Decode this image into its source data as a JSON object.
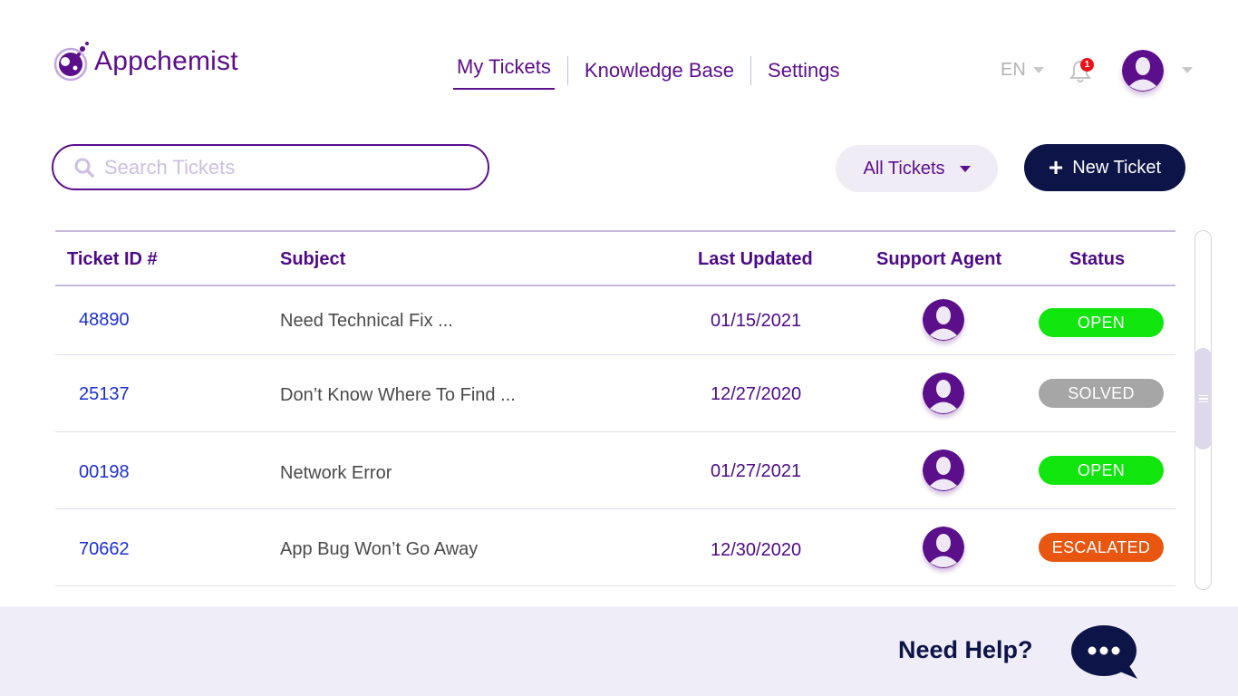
{
  "app": {
    "name": "Appchemist"
  },
  "nav": {
    "items": [
      {
        "label": "My Tickets",
        "active": true
      },
      {
        "label": "Knowledge Base",
        "active": false
      },
      {
        "label": "Settings",
        "active": false
      }
    ]
  },
  "header": {
    "language": "EN",
    "notifications_count": "1",
    "icons": [
      "bell-icon",
      "user-avatar",
      "chevron-down-icon"
    ]
  },
  "toolbar": {
    "search_placeholder": "Search Tickets",
    "filter_label": "All Tickets",
    "new_ticket_label": "New Ticket"
  },
  "table": {
    "columns": [
      "Ticket ID #",
      "Subject",
      "Last Updated",
      "Support Agent",
      "Status"
    ],
    "rows": [
      {
        "id": "48890",
        "subject": "Need Technical Fix ...",
        "updated": "01/15/2021",
        "status": "OPEN",
        "status_color": "#10e50d"
      },
      {
        "id": "25137",
        "subject": "Don’t Know Where To Find ...",
        "updated": "12/27/2020",
        "status": "SOLVED",
        "status_color": "#a6a6a6"
      },
      {
        "id": "00198",
        "subject": "Network Error",
        "updated": "01/27/2021",
        "status": "OPEN",
        "status_color": "#10e50d"
      },
      {
        "id": "70662",
        "subject": "App Bug Won’t Go Away",
        "updated": "12/30/2020",
        "status": "ESCALATED",
        "status_color": "#e8560f"
      }
    ]
  },
  "footer": {
    "help_text": "Need Help?"
  },
  "colors": {
    "brand": "#5c0f8b",
    "dark_navy": "#0d1448",
    "link": "#1c2fd0"
  }
}
